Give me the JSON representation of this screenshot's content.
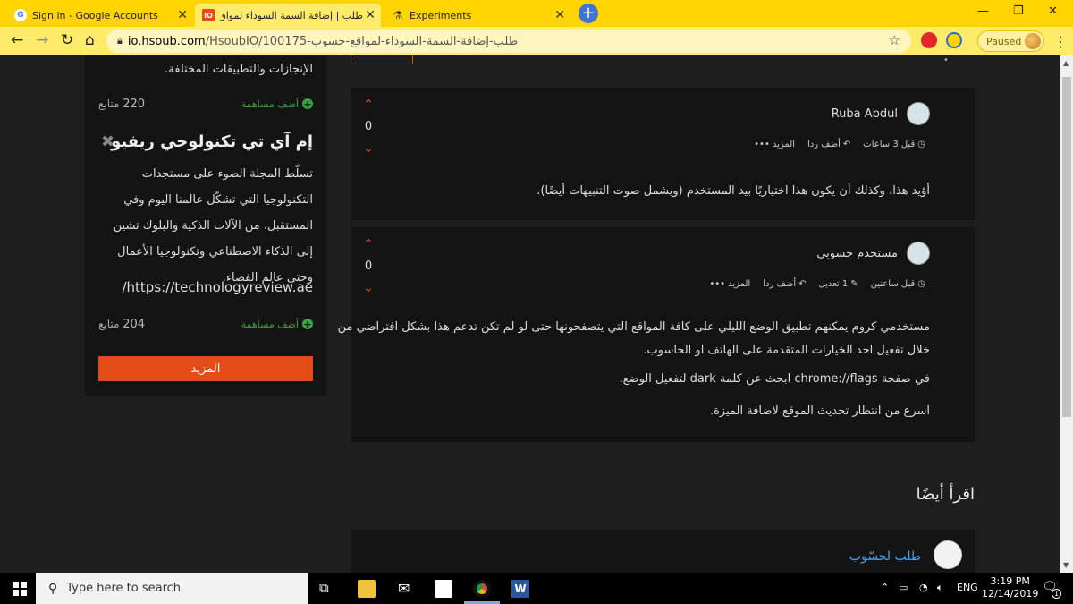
{
  "browser": {
    "tabs": [
      {
        "title": "Sign in - Google Accounts",
        "active": false
      },
      {
        "title": "طلب | إضافة السمة السوداء لمواق",
        "active": true
      },
      {
        "title": "Experiments",
        "active": false
      }
    ],
    "address": {
      "host": "io.hsoub.com",
      "path": "/HsoubIO/100175-طلب-إضافة-السمة-السوداء-لمواقع-حسوب"
    },
    "profile_status": "Paused"
  },
  "sidebar": {
    "top_text": "الإنجازات والتطبيقات المختلفة.",
    "add_contribution_1": "أضف مساهمة",
    "followers_1": "220",
    "followers_label": "متابع",
    "community_title": "إم آي تي تكنولوجي ريفيو",
    "community_desc": "تسلّط المجلة الضوء على مستجدات التكنولوجيا التي تشكّل عالمنا اليوم وفي المستقبل، من الآلات الذكية والبلوك تشين إلى الذكاء الاصطناعي وتكنولوجيا الأعمال وحتى عالم الفضاء.",
    "community_link": "/https://technologyreview.ae",
    "add_contribution_2": "أضف مساهمة",
    "followers_2": "204",
    "more_button": "المزيد"
  },
  "comments": [
    {
      "author": "Ruba Abdul",
      "votes": "0",
      "time": "قبل 3 ساعات",
      "reply": "أضف ردا",
      "more": "المزيد",
      "body": [
        "أؤيد هذا، وكذلك أن يكون هذا اختياريًا بيد المستخدم (ويشمل صوت التنبيهات أيضًا)."
      ]
    },
    {
      "author": "مستخدم حسوبي",
      "votes": "0",
      "time": "قبل ساعتين",
      "edits": "1 تعديل",
      "reply": "أضف ردا",
      "more": "المزيد",
      "body": [
        "مستخدمي كروم يمكنهم تطبيق الوضع الليلي على كافة المواقع التي يتصفحونها حتى لو لم تكن تدعم هذا بشكل افتراضي من",
        "خلال تفعيل احد الخيارات المتقدمة على الهاتف او الحاسوب.",
        "في صفحة chrome://flags ابحث عن كلمة dark لتفعيل الوضع.",
        "اسرع من انتظار تحديث الموقع لاضافة الميزة."
      ]
    }
  ],
  "read_also": {
    "heading": "اقرأ أيضًا",
    "item_title": "طلب لحسّوب"
  },
  "taskbar": {
    "search_placeholder": "Type here to search",
    "language": "ENG",
    "time": "3:19 PM",
    "date": "12/14/2019",
    "notification_count": "1"
  }
}
